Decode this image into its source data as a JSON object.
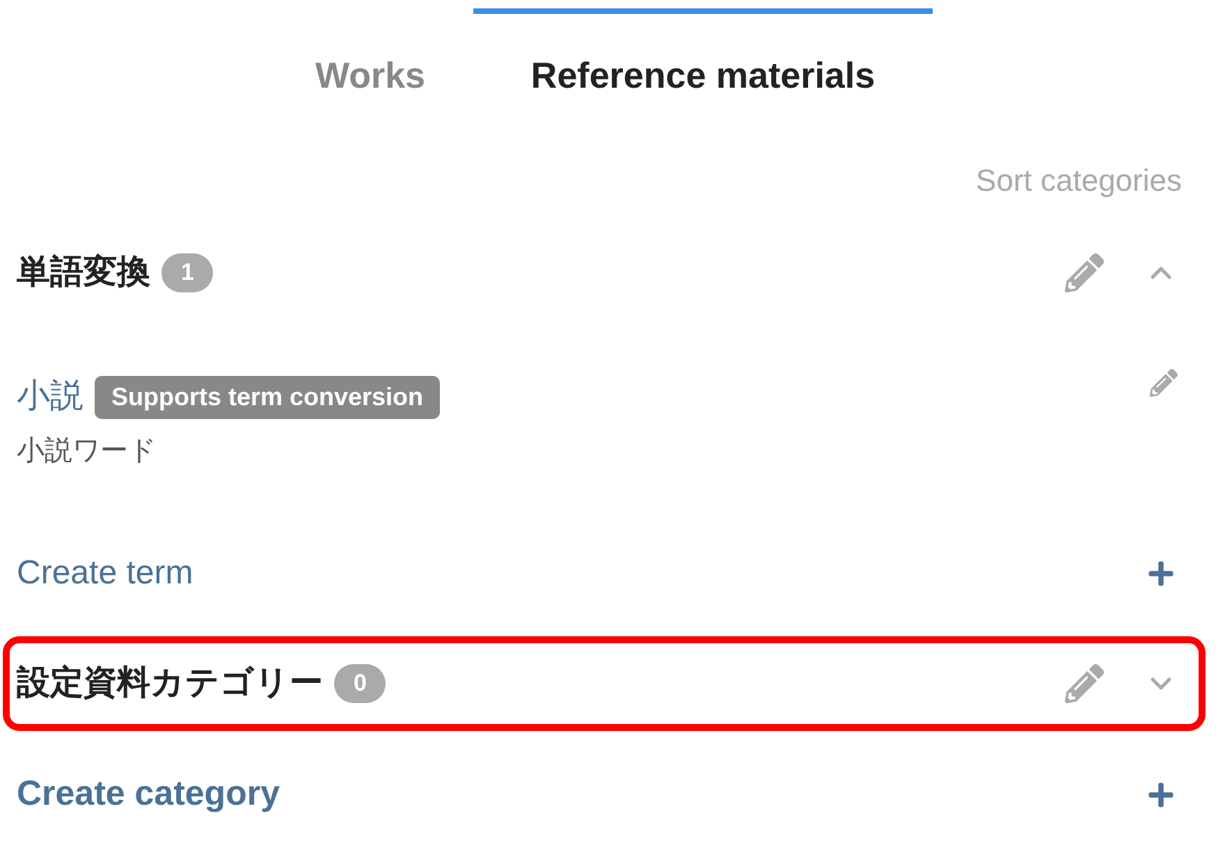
{
  "tabs": [
    {
      "label": "Works",
      "selected": false
    },
    {
      "label": "Reference materials",
      "selected": true
    }
  ],
  "sort_link": "Sort categories",
  "categories": [
    {
      "name": "単語変換",
      "count": "1",
      "expanded": true,
      "highlighted": false,
      "terms": [
        {
          "name": "小説",
          "badge": "Supports term conversion",
          "subtitle": "小説ワード"
        }
      ],
      "create_term": "Create term"
    },
    {
      "name": "設定資料カテゴリー",
      "count": "0",
      "expanded": false,
      "highlighted": true
    }
  ],
  "create_category": "Create category"
}
